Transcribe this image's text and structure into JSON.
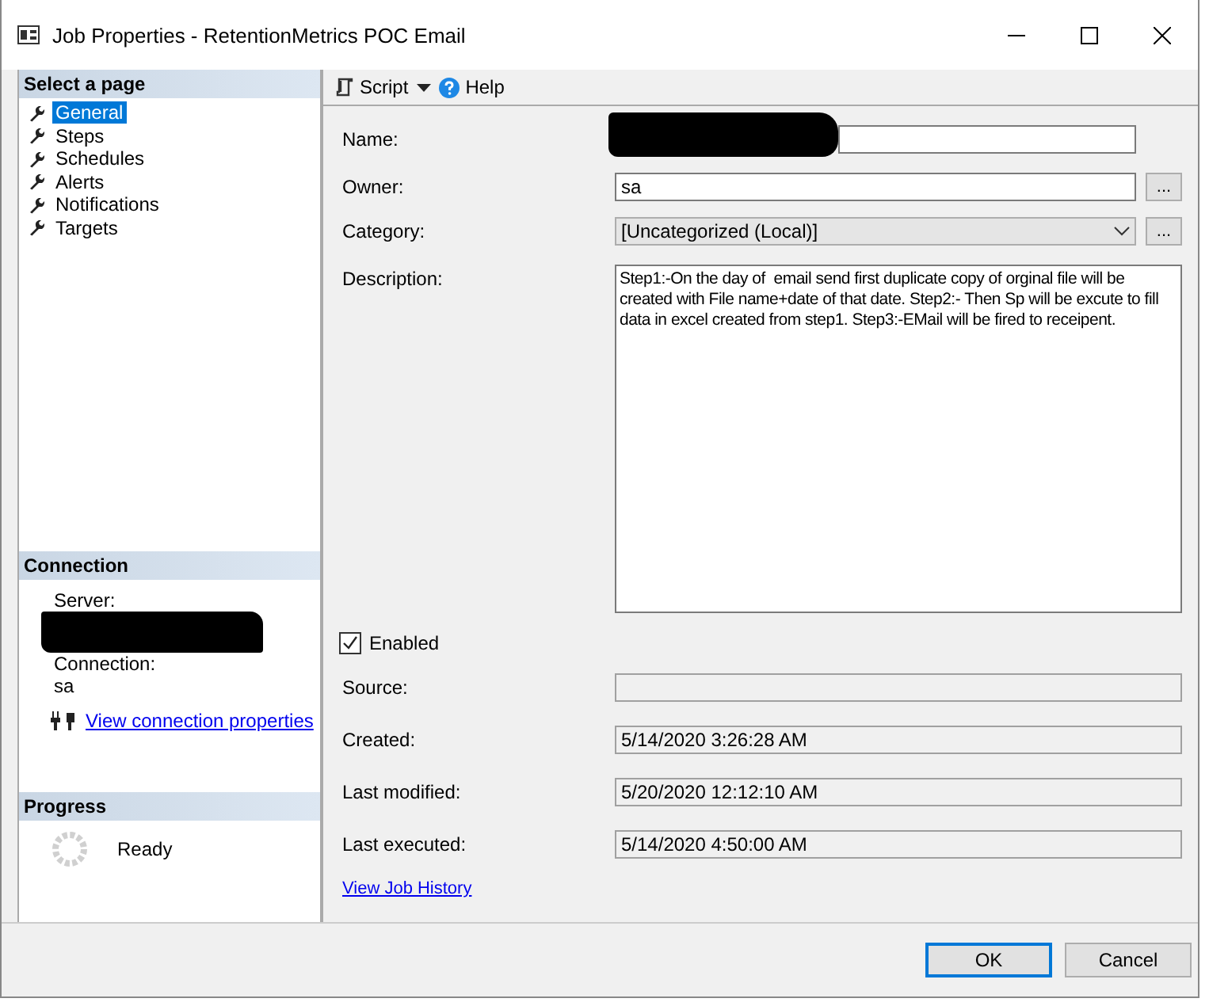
{
  "window": {
    "title": "Job Properties - RetentionMetrics POC Email"
  },
  "sidebar": {
    "header": "Select a page",
    "items": [
      {
        "label": "General",
        "selected": true
      },
      {
        "label": "Steps",
        "selected": false
      },
      {
        "label": "Schedules",
        "selected": false
      },
      {
        "label": "Alerts",
        "selected": false
      },
      {
        "label": "Notifications",
        "selected": false
      },
      {
        "label": "Targets",
        "selected": false
      }
    ]
  },
  "connection": {
    "header": "Connection",
    "server_label": "Server:",
    "server_redacted": true,
    "connection_label": "Connection:",
    "connection_value": "sa",
    "link": "View connection properties"
  },
  "progress": {
    "header": "Progress",
    "status": "Ready"
  },
  "toolbar": {
    "script": "Script",
    "help": "Help"
  },
  "form": {
    "fields": [
      {
        "kind": "text",
        "label": "Name:",
        "redacted": true
      },
      {
        "kind": "text",
        "label": "Owner:",
        "value": "sa",
        "button": "..."
      },
      {
        "kind": "combo",
        "label": "Category:",
        "value": "[Uncategorized (Local)]",
        "button": "..."
      },
      {
        "kind": "textarea",
        "label": "Description:",
        "value": "Step1:-On the day of  email send first duplicate copy of orginal file will be created with File name+date of that date. Step2:- Then Sp will be excute to fill data in excel created from step1. Step3:-EMail will be fired to receipent."
      }
    ],
    "enabled": {
      "label": "Enabled",
      "checked": true
    },
    "info": [
      {
        "label": "Source:"
      },
      {
        "label": "Created:",
        "value": "5/14/2020 3:26:28 AM"
      },
      {
        "label": "Last modified:",
        "value": "5/20/2020 12:12:10 AM"
      },
      {
        "label": "Last executed:",
        "value": "5/14/2020 4:50:00 AM"
      }
    ],
    "link": "View Job History"
  },
  "buttons": [
    {
      "label": "OK",
      "default": true
    },
    {
      "label": "Cancel",
      "default": false
    }
  ]
}
